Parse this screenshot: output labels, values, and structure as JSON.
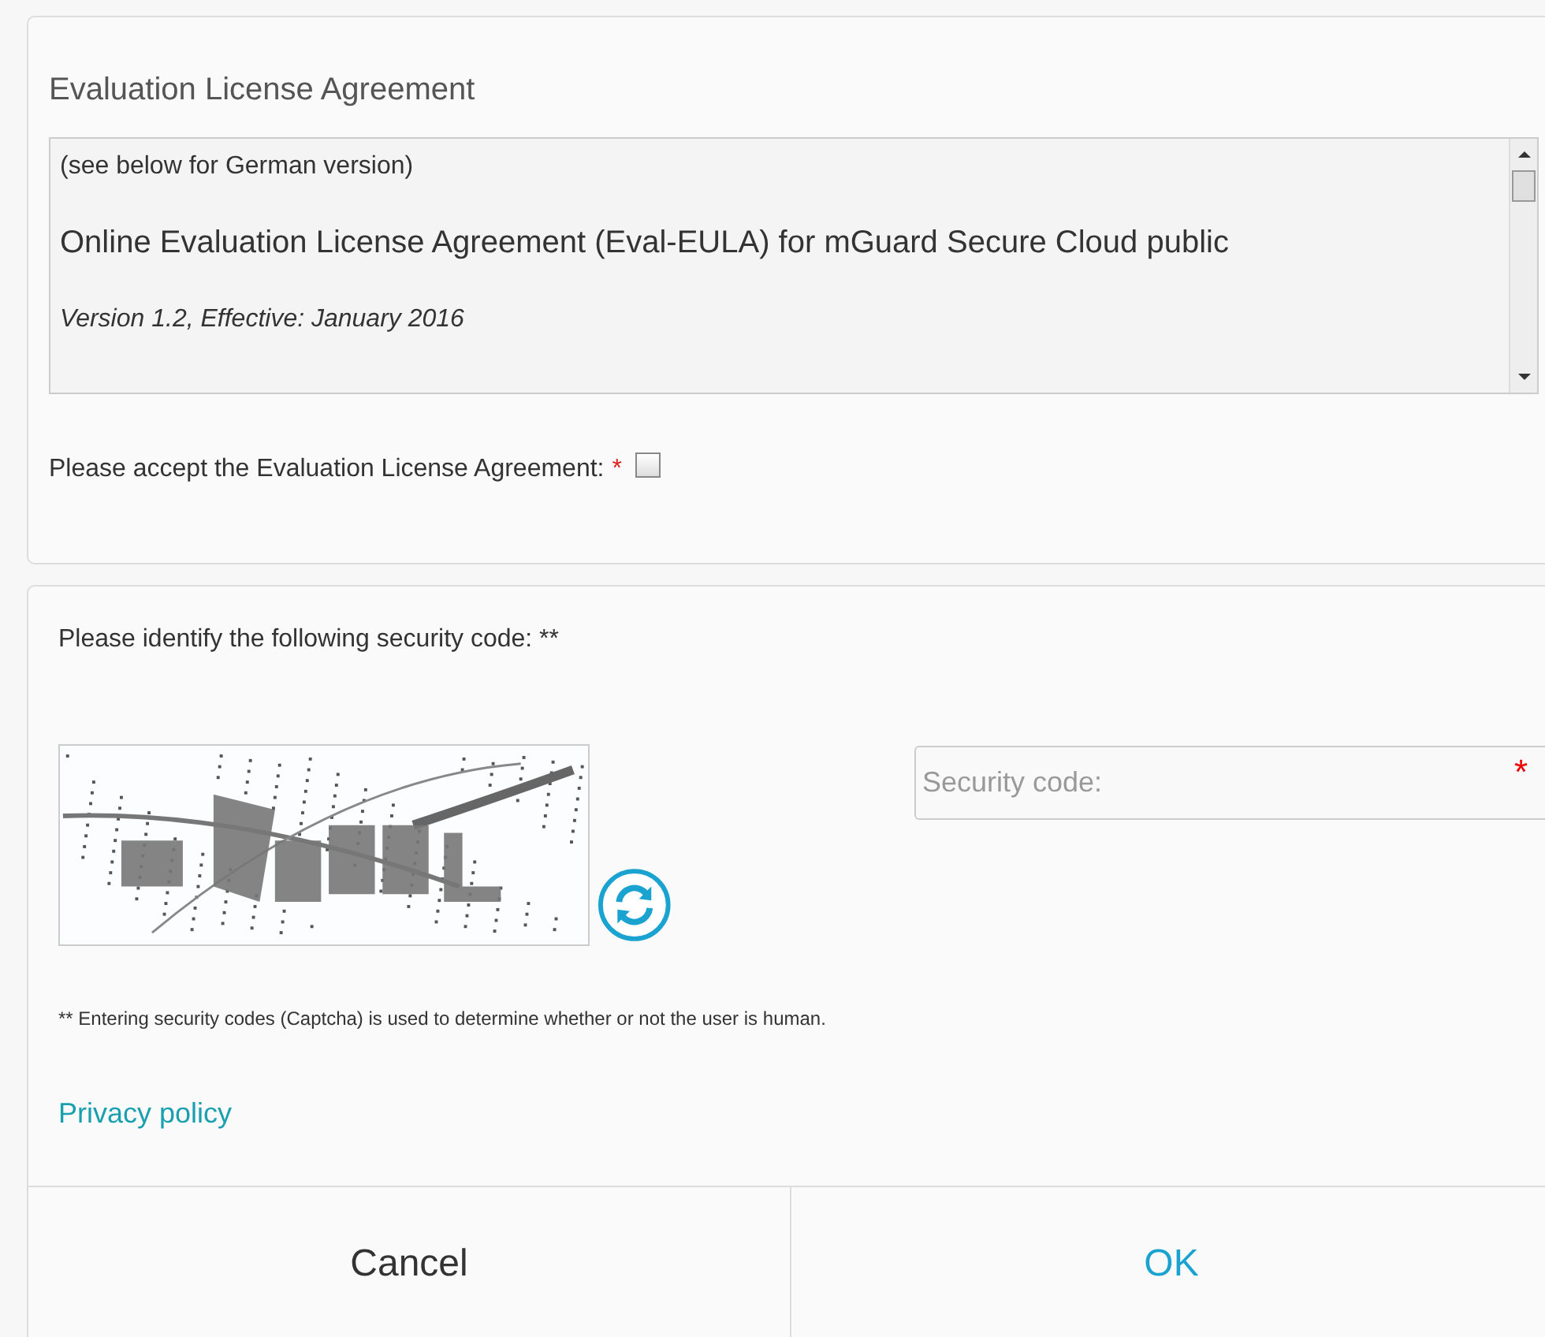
{
  "license": {
    "title": "Evaluation License Agreement",
    "agreement_text": [
      {
        "kind": "note",
        "text": "(see below for German version)"
      },
      {
        "kind": "heading",
        "text": "Online Evaluation License Agreement (Eval-EULA) for mGuard Secure Cloud public"
      },
      {
        "kind": "version",
        "text": "Version 1.2, Effective: January 2016"
      }
    ],
    "accept_label": "Please accept the Evaluation License Agreement:",
    "required_mark": "*",
    "accept_checked": false
  },
  "security": {
    "prompt": "Please identify the following security code: **",
    "code_field": {
      "placeholder": "Security code:",
      "required_mark": "*"
    },
    "footnote": "** Entering security codes (Captcha) is used to determine whether or not the user is human.",
    "privacy_link": "Privacy policy"
  },
  "buttons": [
    {
      "kind": "cancel",
      "label": "Cancel"
    },
    {
      "kind": "ok",
      "label": "OK"
    }
  ]
}
